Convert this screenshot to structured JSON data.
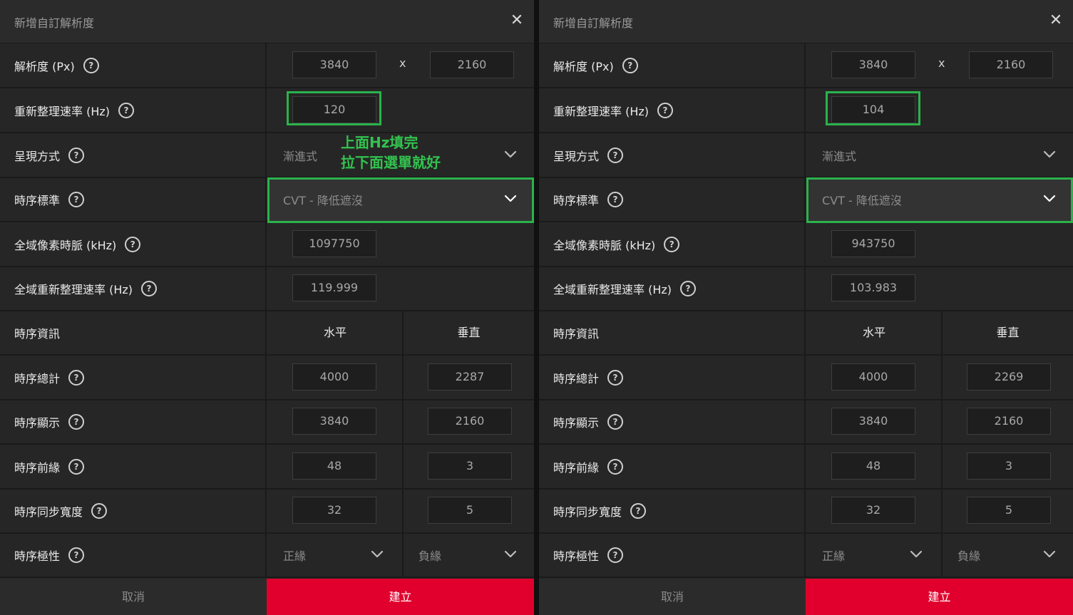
{
  "panels": [
    {
      "title": "新增自訂解析度",
      "rows": {
        "resolution": {
          "label": "解析度 (Px)",
          "width": "3840",
          "sep": "x",
          "height": "2160"
        },
        "refresh": {
          "label": "重新整理速率 (Hz)",
          "value": "120"
        },
        "scan": {
          "label": "呈現方式",
          "value": "漸進式"
        },
        "timing_std": {
          "label": "時序標準",
          "value": "CVT - 降低遮沒"
        },
        "pixel_clock": {
          "label": "全域像素時脈 (kHz)",
          "value": "1097750"
        },
        "global_refresh": {
          "label": "全域重新整理速率 (Hz)",
          "value": "119.999"
        },
        "timing_info": {
          "label": "時序資訊",
          "horizontal": "水平",
          "vertical": "垂直"
        },
        "total": {
          "label": "時序總計",
          "h": "4000",
          "v": "2287"
        },
        "display": {
          "label": "時序顯示",
          "h": "3840",
          "v": "2160"
        },
        "front_porch": {
          "label": "時序前緣",
          "h": "48",
          "v": "3"
        },
        "sync_width": {
          "label": "時序同步寬度",
          "h": "32",
          "v": "5"
        },
        "polarity": {
          "label": "時序極性",
          "h": "正緣",
          "v": "負緣"
        }
      },
      "cancel": "取消",
      "create": "建立"
    },
    {
      "title": "新增自訂解析度",
      "rows": {
        "resolution": {
          "label": "解析度 (Px)",
          "width": "3840",
          "sep": "x",
          "height": "2160"
        },
        "refresh": {
          "label": "重新整理速率 (Hz)",
          "value": "104"
        },
        "scan": {
          "label": "呈現方式",
          "value": "漸進式"
        },
        "timing_std": {
          "label": "時序標準",
          "value": "CVT - 降低遮沒"
        },
        "pixel_clock": {
          "label": "全域像素時脈 (kHz)",
          "value": "943750"
        },
        "global_refresh": {
          "label": "全域重新整理速率 (Hz)",
          "value": "103.983"
        },
        "timing_info": {
          "label": "時序資訊",
          "horizontal": "水平",
          "vertical": "垂直"
        },
        "total": {
          "label": "時序總計",
          "h": "4000",
          "v": "2269"
        },
        "display": {
          "label": "時序顯示",
          "h": "3840",
          "v": "2160"
        },
        "front_porch": {
          "label": "時序前緣",
          "h": "48",
          "v": "3"
        },
        "sync_width": {
          "label": "時序同步寬度",
          "h": "32",
          "v": "5"
        },
        "polarity": {
          "label": "時序極性",
          "h": "正緣",
          "v": "負緣"
        }
      },
      "cancel": "取消",
      "create": "建立"
    }
  ],
  "annotation": "上面Hz填完\n拉下面選單就好",
  "icons": {
    "close": "close-icon",
    "help": "help-circle-icon",
    "dropdown": "chevron-down-icon"
  },
  "colors": {
    "accent": "#e1002d",
    "highlight": "#2bb24c",
    "annotation": "#33c24f"
  }
}
